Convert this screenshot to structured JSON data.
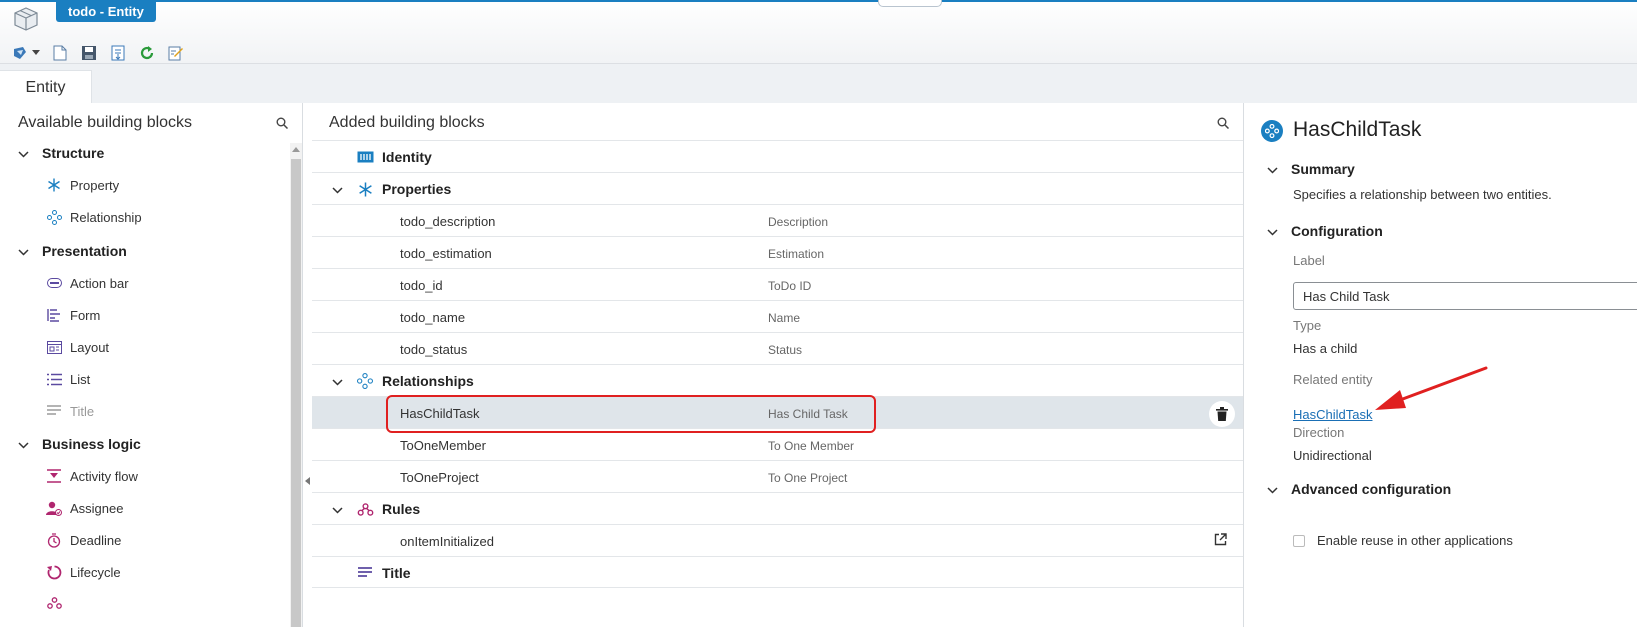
{
  "window": {
    "tab_title": "todo - Entity"
  },
  "tabs": {
    "active": "Entity"
  },
  "left_panel": {
    "title": "Available building blocks",
    "groups": [
      {
        "label": "Structure",
        "items": [
          {
            "label": "Property"
          },
          {
            "label": "Relationship"
          }
        ]
      },
      {
        "label": "Presentation",
        "items": [
          {
            "label": "Action bar"
          },
          {
            "label": "Form"
          },
          {
            "label": "Layout"
          },
          {
            "label": "List"
          },
          {
            "label": "Title"
          }
        ]
      },
      {
        "label": "Business logic",
        "items": [
          {
            "label": "Activity flow"
          },
          {
            "label": "Assignee"
          },
          {
            "label": "Deadline"
          },
          {
            "label": "Lifecycle"
          }
        ]
      }
    ]
  },
  "middle_panel": {
    "title": "Added building blocks",
    "identity": "Identity",
    "properties": {
      "label": "Properties",
      "rows": [
        {
          "name": "todo_description",
          "label": "Description"
        },
        {
          "name": "todo_estimation",
          "label": "Estimation"
        },
        {
          "name": "todo_id",
          "label": "ToDo ID"
        },
        {
          "name": "todo_name",
          "label": "Name"
        },
        {
          "name": "todo_status",
          "label": "Status"
        }
      ]
    },
    "relationships": {
      "label": "Relationships",
      "rows": [
        {
          "name": "HasChildTask",
          "label": "Has Child Task"
        },
        {
          "name": "ToOneMember",
          "label": "To One Member"
        },
        {
          "name": "ToOneProject",
          "label": "To One Project"
        }
      ]
    },
    "rules": {
      "label": "Rules",
      "rows": [
        {
          "name": "onItemInitialized"
        }
      ]
    },
    "title_block": "Title"
  },
  "right_panel": {
    "title": "HasChildTask",
    "summary": {
      "heading": "Summary",
      "text": "Specifies a relationship between two entities."
    },
    "configuration": {
      "heading": "Configuration",
      "label_caption": "Label",
      "label_value": "Has Child Task",
      "type_caption": "Type",
      "type_value": "Has a child",
      "related_caption": "Related entity",
      "related_value": "HasChildTask",
      "direction_caption": "Direction",
      "direction_value": "Unidirectional"
    },
    "advanced": {
      "heading": "Advanced configuration",
      "reuse_label": "Enable reuse in other applications",
      "reuse_checked": false
    }
  },
  "colors": {
    "accent": "#1a7fc1",
    "highlight": "#e02020",
    "selected_row": "#dfe5ea"
  }
}
